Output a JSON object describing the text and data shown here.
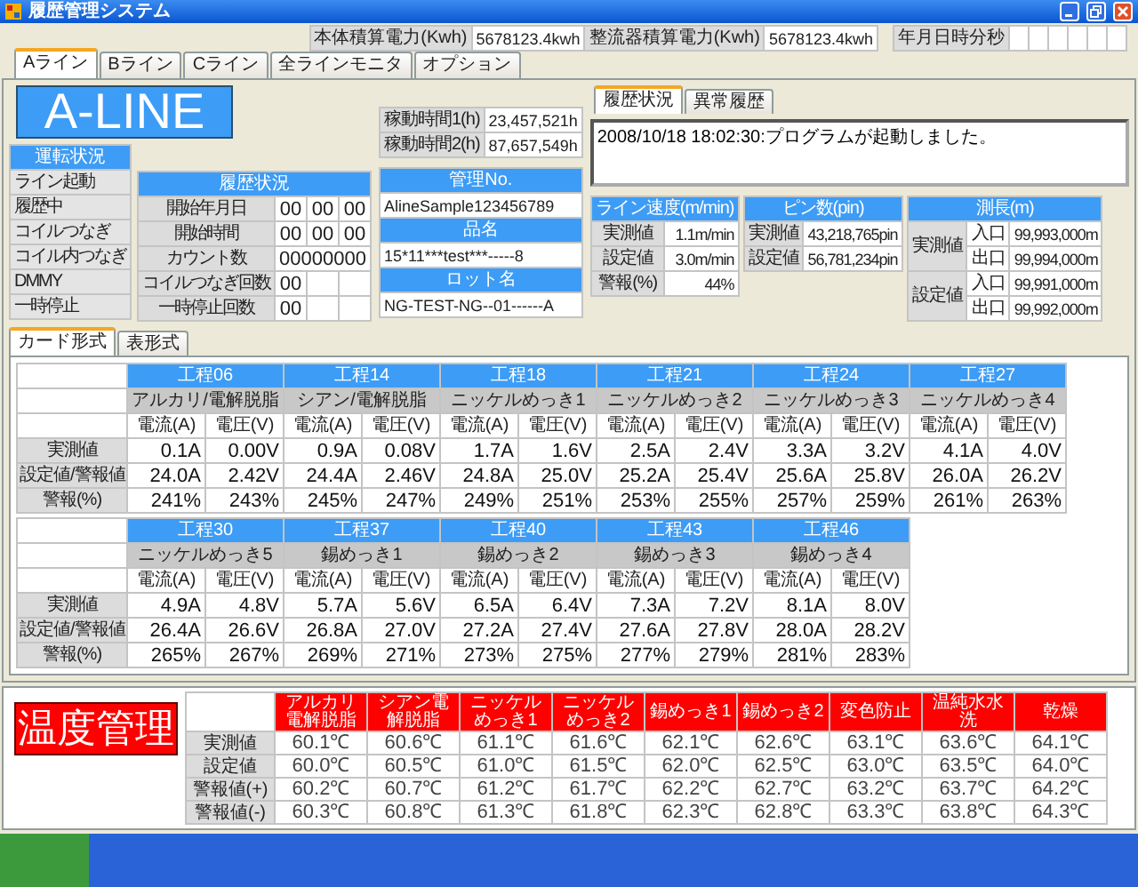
{
  "window": {
    "title": "履歴管理システム"
  },
  "energy": [
    {
      "label": "本体積算電力(Kwh)",
      "value": "5678123.4kwh"
    },
    {
      "label": "整流器積算電力(Kwh)",
      "value": "5678123.4kwh"
    }
  ],
  "clock": {
    "label": "年月日時分秒"
  },
  "line_tabs": [
    {
      "label": "Aライン",
      "selected": true
    },
    {
      "label": "Bライン",
      "selected": false
    },
    {
      "label": "Cライン",
      "selected": false
    },
    {
      "label": "全ラインモニタ",
      "selected": false
    },
    {
      "label": "オプション",
      "selected": false
    }
  ],
  "line_name": "A-LINE",
  "run_status": {
    "title": "運転状況",
    "items": [
      "ライン起動",
      "履歴中",
      "コイルつなぎ",
      "コイル内つなぎ",
      "DMMY",
      "一時停止"
    ]
  },
  "history": {
    "title": "履歴状況",
    "rows": [
      {
        "label": "開始年月日",
        "kind": "split",
        "values": [
          "00",
          "00",
          "00"
        ]
      },
      {
        "label": "開始時間",
        "kind": "split",
        "values": [
          "00",
          "00",
          "00"
        ]
      },
      {
        "label": "カウント数",
        "kind": "wide",
        "values": [
          "00000000"
        ]
      },
      {
        "label": "コイルつなぎ回数",
        "kind": "split",
        "values": [
          "00"
        ]
      },
      {
        "label": "一時停止回数",
        "kind": "split",
        "values": [
          "00"
        ]
      }
    ]
  },
  "operating_hours": [
    {
      "label": "稼動時間1(h)",
      "value": "23,457,521h"
    },
    {
      "label": "稼動時間2(h)",
      "value": "87,657,549h"
    }
  ],
  "info": [
    {
      "title": "管理No.",
      "value": "AlineSample123456789"
    },
    {
      "title": "品名",
      "value": "15*11***test***-----8"
    },
    {
      "title": "ロット名",
      "value": "NG-TEST-NG--01------A"
    }
  ],
  "log": {
    "tabs": [
      {
        "label": "履歴状況",
        "selected": true
      },
      {
        "label": "異常履歴",
        "selected": false
      }
    ],
    "lines": [
      "2008/10/18 18:02:30:プログラムが起動しました。"
    ]
  },
  "line_speed": {
    "title": "ライン速度(m/min)",
    "rows": [
      {
        "label": "実測値",
        "value": "1.1m/min"
      },
      {
        "label": "設定値",
        "value": "3.0m/min"
      },
      {
        "label": "警報(%)",
        "value": "44%"
      }
    ]
  },
  "pin_count": {
    "title": "ピン数(pin)",
    "rows": [
      {
        "label": "実測値",
        "value": "43,218,765pin"
      },
      {
        "label": "設定値",
        "value": "56,781,234pin"
      }
    ]
  },
  "length": {
    "title": "測長(m)",
    "groups": [
      {
        "label": "実測値",
        "rows": [
          {
            "label": "入口",
            "value": "99,993,000m"
          },
          {
            "label": "出口",
            "value": "99,994,000m"
          }
        ]
      },
      {
        "label": "設定値",
        "rows": [
          {
            "label": "入口",
            "value": "99,991,000m"
          },
          {
            "label": "出口",
            "value": "99,992,000m"
          }
        ]
      }
    ]
  },
  "view_tabs": [
    {
      "label": "カード形式",
      "selected": true
    },
    {
      "label": "表形式",
      "selected": false
    }
  ],
  "process_blocks": [
    {
      "row_labels": [
        "実測値",
        "設定値/警報値",
        "警報(%)"
      ],
      "processes": [
        {
          "step": "工程06",
          "name": "アルカリ/電解脱脂",
          "columns": [
            "電流(A)",
            "電圧(V)"
          ],
          "rows": [
            [
              "0.1A",
              "0.00V"
            ],
            [
              "24.0A",
              "2.42V"
            ],
            [
              "241%",
              "243%"
            ]
          ]
        },
        {
          "step": "工程14",
          "name": "シアン/電解脱脂",
          "columns": [
            "電流(A)",
            "電圧(V)"
          ],
          "rows": [
            [
              "0.9A",
              "0.08V"
            ],
            [
              "24.4A",
              "2.46V"
            ],
            [
              "245%",
              "247%"
            ]
          ]
        },
        {
          "step": "工程18",
          "name": "ニッケルめっき1",
          "columns": [
            "電流(A)",
            "電圧(V)"
          ],
          "rows": [
            [
              "1.7A",
              "1.6V"
            ],
            [
              "24.8A",
              "25.0V"
            ],
            [
              "249%",
              "251%"
            ]
          ]
        },
        {
          "step": "工程21",
          "name": "ニッケルめっき2",
          "columns": [
            "電流(A)",
            "電圧(V)"
          ],
          "rows": [
            [
              "2.5A",
              "2.4V"
            ],
            [
              "25.2A",
              "25.4V"
            ],
            [
              "253%",
              "255%"
            ]
          ]
        },
        {
          "step": "工程24",
          "name": "ニッケルめっき3",
          "columns": [
            "電流(A)",
            "電圧(V)"
          ],
          "rows": [
            [
              "3.3A",
              "3.2V"
            ],
            [
              "25.6A",
              "25.8V"
            ],
            [
              "257%",
              "259%"
            ]
          ]
        },
        {
          "step": "工程27",
          "name": "ニッケルめっき4",
          "columns": [
            "電流(A)",
            "電圧(V)"
          ],
          "rows": [
            [
              "4.1A",
              "4.0V"
            ],
            [
              "26.0A",
              "26.2V"
            ],
            [
              "261%",
              "263%"
            ]
          ]
        }
      ]
    },
    {
      "row_labels": [
        "実測値",
        "設定値/警報値",
        "警報(%)"
      ],
      "processes": [
        {
          "step": "工程30",
          "name": "ニッケルめっき5",
          "columns": [
            "電流(A)",
            "電圧(V)"
          ],
          "rows": [
            [
              "4.9A",
              "4.8V"
            ],
            [
              "26.4A",
              "26.6V"
            ],
            [
              "265%",
              "267%"
            ]
          ]
        },
        {
          "step": "工程37",
          "name": "錫めっき1",
          "columns": [
            "電流(A)",
            "電圧(V)"
          ],
          "rows": [
            [
              "5.7A",
              "5.6V"
            ],
            [
              "26.8A",
              "27.0V"
            ],
            [
              "269%",
              "271%"
            ]
          ]
        },
        {
          "step": "工程40",
          "name": "錫めっき2",
          "columns": [
            "電流(A)",
            "電圧(V)"
          ],
          "rows": [
            [
              "6.5A",
              "6.4V"
            ],
            [
              "27.2A",
              "27.4V"
            ],
            [
              "273%",
              "275%"
            ]
          ]
        },
        {
          "step": "工程43",
          "name": "錫めっき3",
          "columns": [
            "電流(A)",
            "電圧(V)"
          ],
          "rows": [
            [
              "7.3A",
              "7.2V"
            ],
            [
              "27.6A",
              "27.8V"
            ],
            [
              "277%",
              "279%"
            ]
          ]
        },
        {
          "step": "工程46",
          "name": "錫めっき4",
          "columns": [
            "電流(A)",
            "電圧(V)"
          ],
          "rows": [
            [
              "8.1A",
              "8.0V"
            ],
            [
              "28.0A",
              "28.2V"
            ],
            [
              "281%",
              "283%"
            ]
          ]
        }
      ]
    }
  ],
  "temperature": {
    "title": "温度管理",
    "columns": [
      "アルカリ電解脱脂",
      "シアン電解脱脂",
      "ニッケルめっき1",
      "ニッケルめっき2",
      "錫めっき1",
      "錫めっき2",
      "変色防止",
      "温純水水洗",
      "乾燥"
    ],
    "rows": [
      {
        "label": "実測値",
        "values": [
          "60.1℃",
          "60.6℃",
          "61.1℃",
          "61.6℃",
          "62.1℃",
          "62.6℃",
          "63.1℃",
          "63.6℃",
          "64.1℃"
        ]
      },
      {
        "label": "設定値",
        "values": [
          "60.0℃",
          "60.5℃",
          "61.0℃",
          "61.5℃",
          "62.0℃",
          "62.5℃",
          "63.0℃",
          "63.5℃",
          "64.0℃"
        ]
      },
      {
        "label": "警報値(+)",
        "values": [
          "60.2℃",
          "60.7℃",
          "61.2℃",
          "61.7℃",
          "62.2℃",
          "62.7℃",
          "63.2℃",
          "63.7℃",
          "64.2℃"
        ]
      },
      {
        "label": "警報値(-)",
        "values": [
          "60.3℃",
          "60.8℃",
          "61.3℃",
          "61.8℃",
          "62.3℃",
          "62.8℃",
          "63.3℃",
          "63.8℃",
          "64.3℃"
        ]
      }
    ]
  }
}
